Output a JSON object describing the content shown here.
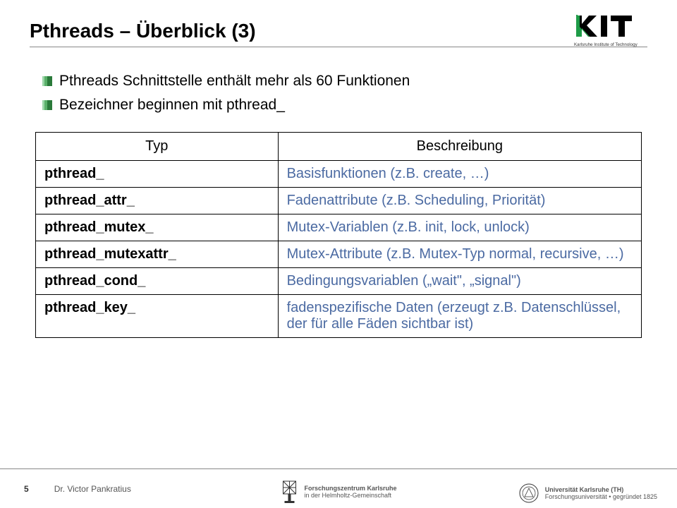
{
  "title": "Pthreads – Überblick (3)",
  "logo": {
    "text_top": "",
    "text_bottom": "Karlsruhe Institute of Technology"
  },
  "bullets": [
    "Pthreads Schnittstelle enthält mehr als 60 Funktionen",
    "Bezeichner beginnen mit pthread_"
  ],
  "table": {
    "header": {
      "col0": "Typ",
      "col1": "Beschreibung"
    },
    "rows": [
      {
        "typ": "pthread_",
        "desc": "Basisfunktionen (z.B. create, …)"
      },
      {
        "typ": "pthread_attr_",
        "desc": "Fadenattribute (z.B. Scheduling, Priorität)"
      },
      {
        "typ": "pthread_mutex_",
        "desc": "Mutex-Variablen (z.B. init, lock, unlock)"
      },
      {
        "typ": "pthread_mutexattr_",
        "desc": "Mutex-Attribute (z.B. Mutex-Typ normal, recursive, …)"
      },
      {
        "typ": "pthread_cond_",
        "desc": "Bedingungsvariablen („wait\", „signal\")"
      },
      {
        "typ": "pthread_key_",
        "desc": "fadenspezifische Daten (erzeugt z.B. Datenschlüssel, der für alle Fäden sichtbar ist)"
      }
    ]
  },
  "footer": {
    "page": "5",
    "author": "Dr. Victor Pankratius",
    "center1": "Forschungszentrum Karlsruhe",
    "center2": "in der Helmholtz-Gemeinschaft",
    "right1": "Universität Karlsruhe (TH)",
    "right2": "Forschungsuniversität • gegründet 1825"
  }
}
